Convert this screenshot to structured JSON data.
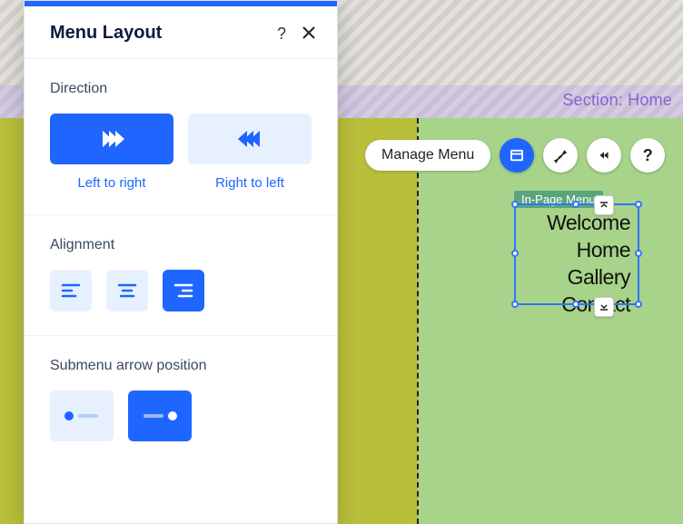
{
  "section_label": "Section: Home",
  "toolbar": {
    "manage_label": "Manage Menu"
  },
  "menu_widget": {
    "tag": "In-Page Menu",
    "items": [
      "Welcome",
      "Home",
      "Gallery",
      "Contact"
    ]
  },
  "panel": {
    "title": "Menu Layout",
    "direction": {
      "label": "Direction",
      "options": [
        "Left to right",
        "Right to left"
      ],
      "selected": 0
    },
    "alignment": {
      "label": "Alignment",
      "selected": 2
    },
    "submenu": {
      "label": "Submenu arrow position",
      "selected": 1
    }
  }
}
